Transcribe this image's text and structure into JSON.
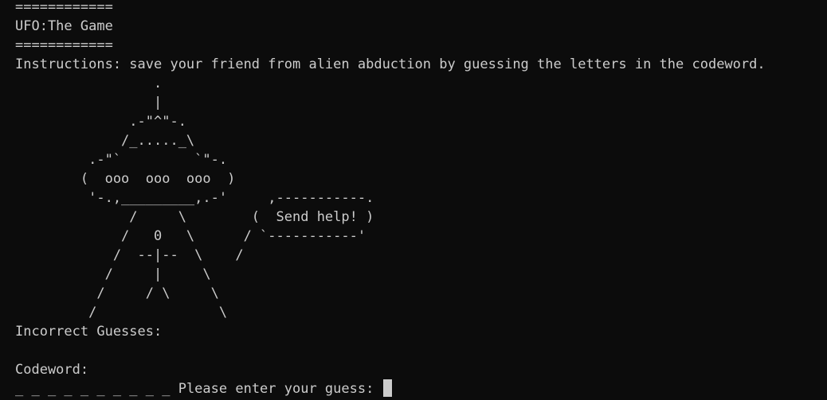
{
  "terminal": {
    "lines": [
      "============",
      "UFO:The Game",
      "============",
      "Instructions: save your friend from alien abduction by guessing the letters in the codeword.",
      "                 .",
      "                 |",
      "              .-\"^\"-.",
      "             /_....._\\",
      "         .-\"`         `\"-.",
      "        (  ooo  ooo  ooo  )",
      "         '-.,_________,.-'     ,-----------.",
      "              /     \\        (  Send help! )",
      "             /   0   \\      / `-----------'",
      "            /  --|--  \\    /",
      "           /     |     \\",
      "          /     / \\     \\",
      "         /               \\",
      "Incorrect Guesses:",
      "",
      "Codeword:"
    ],
    "codeword_blanks": "_ _ _ _ _ _ _ _ _ _",
    "prompt": " Please enter your guess: "
  }
}
